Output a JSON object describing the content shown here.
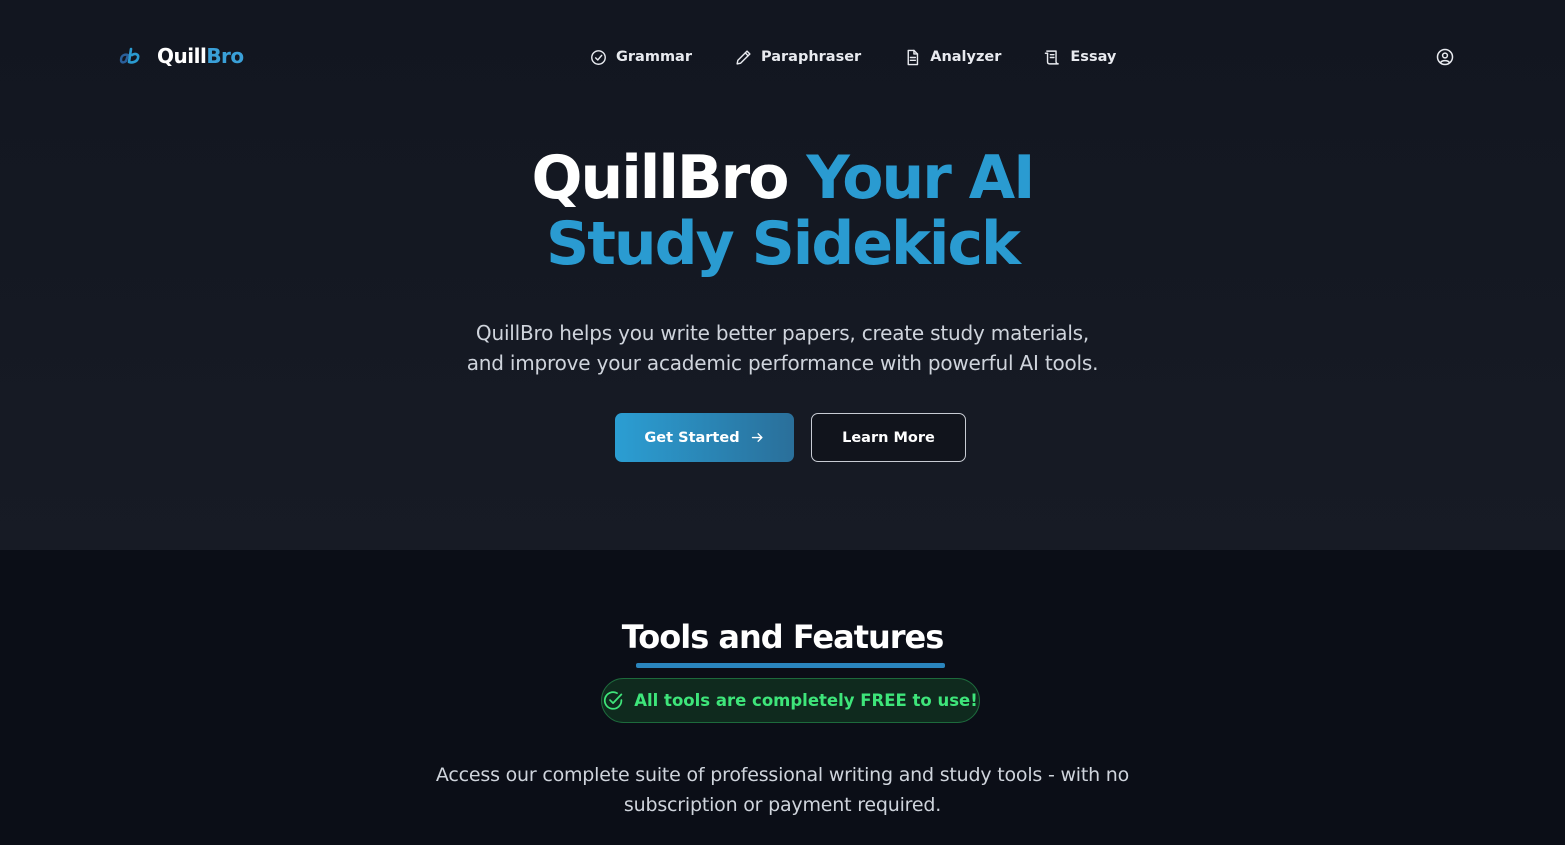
{
  "nav": {
    "logo": {
      "part1": "Quill",
      "part2": "Bro",
      "mark_icon": "quillbro-logo-icon"
    },
    "links": [
      {
        "label": "Grammar",
        "icon": "check-circle-icon"
      },
      {
        "label": "Paraphraser",
        "icon": "pencil-icon"
      },
      {
        "label": "Analyzer",
        "icon": "document-icon"
      },
      {
        "label": "Essay",
        "icon": "scroll-icon"
      }
    ],
    "account_icon": "user-circle-icon"
  },
  "hero": {
    "title_part1": "QuillBro",
    "title_part2": "Your AI",
    "title_line2": "Study Sidekick",
    "subtitle_line1": "QuillBro helps you write better papers, create study materials,",
    "subtitle_line2": "and improve your academic performance with powerful AI tools.",
    "primary_button": "Get Started",
    "secondary_button": "Learn More"
  },
  "tools": {
    "title": "Tools and Features",
    "badge": "All tools are completely FREE to use!",
    "desc_line1": "Access our complete suite of professional writing and study tools - with no",
    "desc_line2": "subscription or payment required."
  },
  "colors": {
    "accent": "#2a9bd1",
    "background": "#0b0e17",
    "badge_green": "#3ee57a"
  }
}
